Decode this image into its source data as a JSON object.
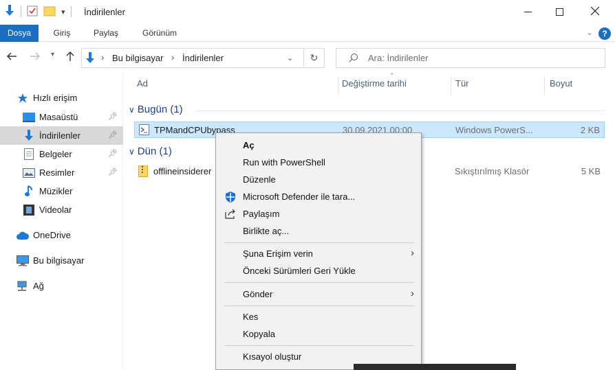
{
  "window": {
    "title": "İndirilenler",
    "controls": [
      "minimize-icon",
      "maximize-icon",
      "close-icon"
    ]
  },
  "ribbon": {
    "tabs": [
      {
        "label": "Dosya",
        "active": true
      },
      {
        "label": "Giriş",
        "active": false
      },
      {
        "label": "Paylaş",
        "active": false
      },
      {
        "label": "Görünüm",
        "active": false
      }
    ],
    "help": "?"
  },
  "address": {
    "crumbs": [
      "Bu bilgisayar",
      "İndirilenler"
    ],
    "search_placeholder": "Ara: İndirilenler"
  },
  "sidebar": {
    "items": [
      {
        "label": "Hızlı erişim",
        "icon": "star-icon",
        "pinned": false,
        "selected": false
      },
      {
        "label": "Masaüstü",
        "icon": "desktop-icon",
        "pinned": true,
        "selected": false
      },
      {
        "label": "İndirilenler",
        "icon": "download-arrow-icon",
        "pinned": true,
        "selected": true
      },
      {
        "label": "Belgeler",
        "icon": "document-icon",
        "pinned": true,
        "selected": false
      },
      {
        "label": "Resimler",
        "icon": "picture-icon",
        "pinned": true,
        "selected": false
      },
      {
        "label": "Müzikler",
        "icon": "music-note-icon",
        "pinned": false,
        "selected": false
      },
      {
        "label": "Videolar",
        "icon": "film-icon",
        "pinned": false,
        "selected": false
      },
      {
        "label": "OneDrive",
        "icon": "cloud-icon",
        "pinned": false,
        "selected": false
      },
      {
        "label": "Bu bilgisayar",
        "icon": "computer-icon",
        "pinned": false,
        "selected": false
      },
      {
        "label": "Ağ",
        "icon": "network-icon",
        "pinned": false,
        "selected": false
      }
    ]
  },
  "columns": {
    "name": "Ad",
    "modified": "Değiştirme tarihi",
    "type": "Tür",
    "size": "Boyut"
  },
  "groups": [
    {
      "label": "Bugün (1)",
      "files": [
        {
          "name": "TPMandCPUbypass",
          "modified": "30.09.2021 00:00",
          "type": "Windows PowerS...",
          "size": "2 KB",
          "icon": "powershell-script-icon",
          "selected": true
        }
      ]
    },
    {
      "label": "Dün (1)",
      "files": [
        {
          "name": "offlineinsiderer",
          "modified": "",
          "type": "Sıkıştırılmış Klasör",
          "size": "5 KB",
          "icon": "zip-folder-icon",
          "selected": false
        }
      ]
    }
  ],
  "context_menu": {
    "items": [
      {
        "label": "Aç",
        "bold": true
      },
      {
        "label": "Run with PowerShell"
      },
      {
        "label": "Düzenle"
      },
      {
        "label": "Microsoft Defender ile tara...",
        "icon": "defender-shield-icon"
      },
      {
        "label": "Paylaşım",
        "icon": "share-icon"
      },
      {
        "label": "Birlikte aç..."
      },
      {
        "label": "Şuna Erişim verin",
        "submenu": true
      },
      {
        "label": "Önceki Sürümleri Geri Yükle"
      },
      {
        "label": "Gönder",
        "submenu": true
      },
      {
        "label": "Kes"
      },
      {
        "label": "Kopyala"
      },
      {
        "label": "Kısayol oluştur"
      }
    ]
  },
  "colors": {
    "accent": "#1a6fc4",
    "selection": "#cce8ff",
    "group_text": "#1e3f8a"
  }
}
